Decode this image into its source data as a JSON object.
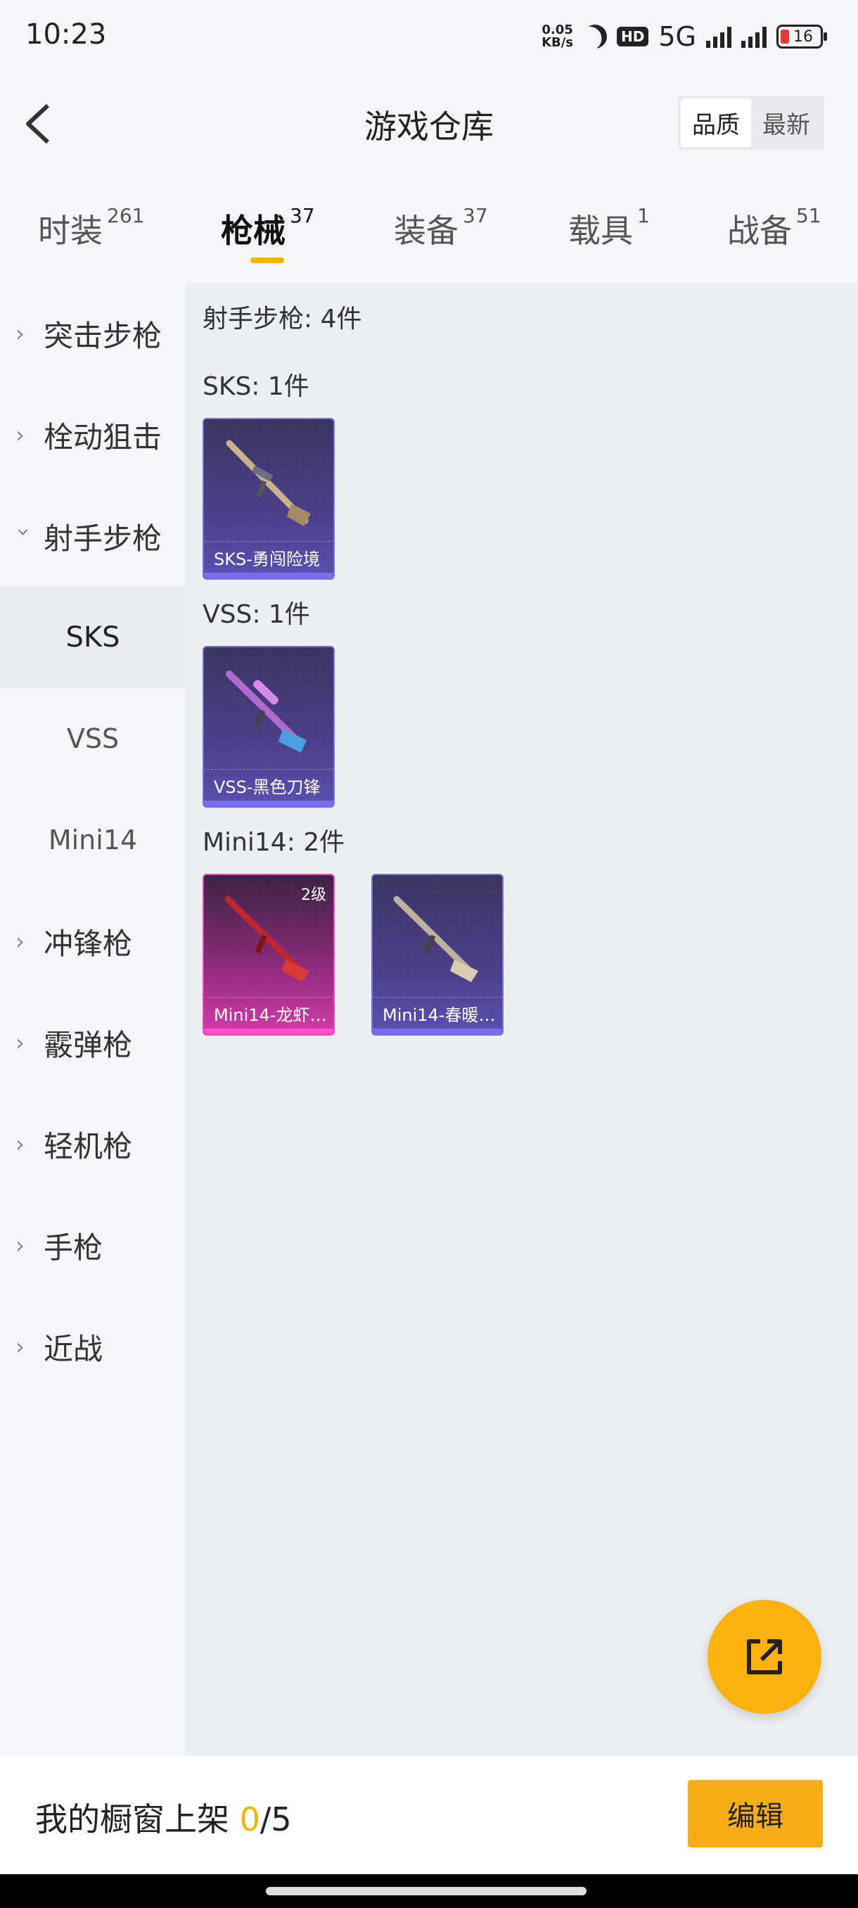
{
  "status": {
    "time": "10:23",
    "speed_top": "0.05",
    "speed_bottom": "KB/s",
    "hd": "HD",
    "network": "5G",
    "battery": "16"
  },
  "header": {
    "title": "游戏仓库",
    "sort_quality": "品质",
    "sort_newest": "最新"
  },
  "tabs": [
    {
      "label": "时装",
      "count": "261"
    },
    {
      "label": "枪械",
      "count": "37"
    },
    {
      "label": "装备",
      "count": "37"
    },
    {
      "label": "载具",
      "count": "1"
    },
    {
      "label": "战备",
      "count": "51"
    }
  ],
  "sidebar": {
    "items": [
      {
        "label": "突击步枪"
      },
      {
        "label": "栓动狙击"
      },
      {
        "label": "射手步枪"
      },
      {
        "label": "冲锋枪"
      },
      {
        "label": "霰弹枪"
      },
      {
        "label": "轻机枪"
      },
      {
        "label": "手枪"
      },
      {
        "label": "近战"
      }
    ],
    "subitems": [
      {
        "label": "SKS"
      },
      {
        "label": "VSS"
      },
      {
        "label": "Mini14"
      }
    ]
  },
  "content": {
    "summary": "射手步枪: 4件",
    "groups": [
      {
        "label": "SKS: 1件",
        "cards": [
          {
            "name": "SKS-勇闯险境",
            "level": ""
          }
        ]
      },
      {
        "label": "VSS: 1件",
        "cards": [
          {
            "name": "VSS-黑色刀锋",
            "level": ""
          }
        ]
      },
      {
        "label": "Mini14: 2件",
        "cards": [
          {
            "name": "Mini14-龙虾…",
            "level": "2级"
          },
          {
            "name": "Mini14-春暖…",
            "level": ""
          }
        ]
      }
    ]
  },
  "bottom": {
    "showcase_label": "我的橱窗上架 ",
    "showcase_count": "0",
    "showcase_total": "/5",
    "edit_label": "编辑"
  },
  "colors": {
    "accent": "#f5b400",
    "rare_purple": "#7a6cf0",
    "rare_pink": "#ff4fd0"
  },
  "icons": {
    "back": "chevron-left-icon",
    "share": "share-external-icon",
    "expand": "chevron-right-icon"
  }
}
